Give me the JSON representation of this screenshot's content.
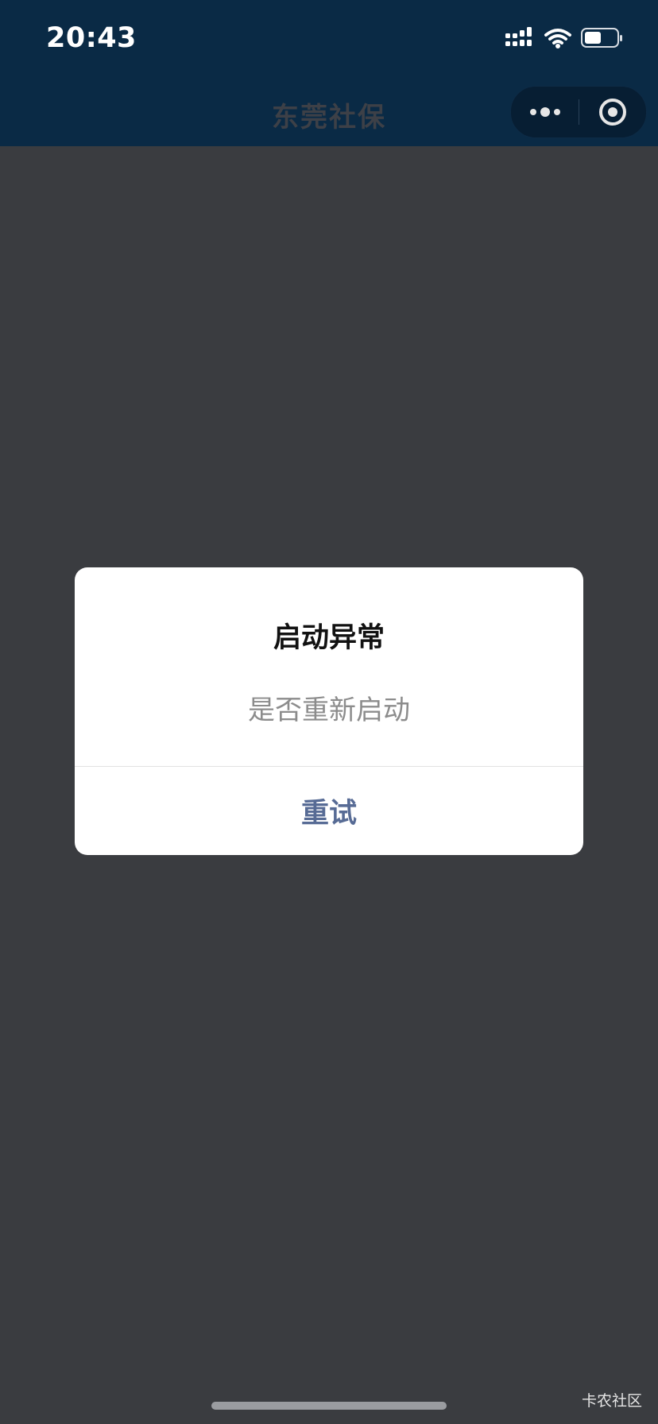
{
  "status_bar": {
    "time": "20:43",
    "icons": [
      "cellular-signal-icon",
      "wifi-icon",
      "battery-icon"
    ],
    "battery_level": 0.5
  },
  "nav_bar": {
    "title": "东莞社保",
    "buttons": [
      "more-dots-icon",
      "close-target-icon"
    ]
  },
  "dialog": {
    "title": "启动异常",
    "message": "是否重新启动",
    "button_label": "重试",
    "button_color": "#576b95"
  },
  "watermark": "卡农社区",
  "colors": {
    "header_bg": "#0a2a45",
    "overlay_bg": "#3a3c40",
    "dialog_bg": "#ffffff"
  }
}
